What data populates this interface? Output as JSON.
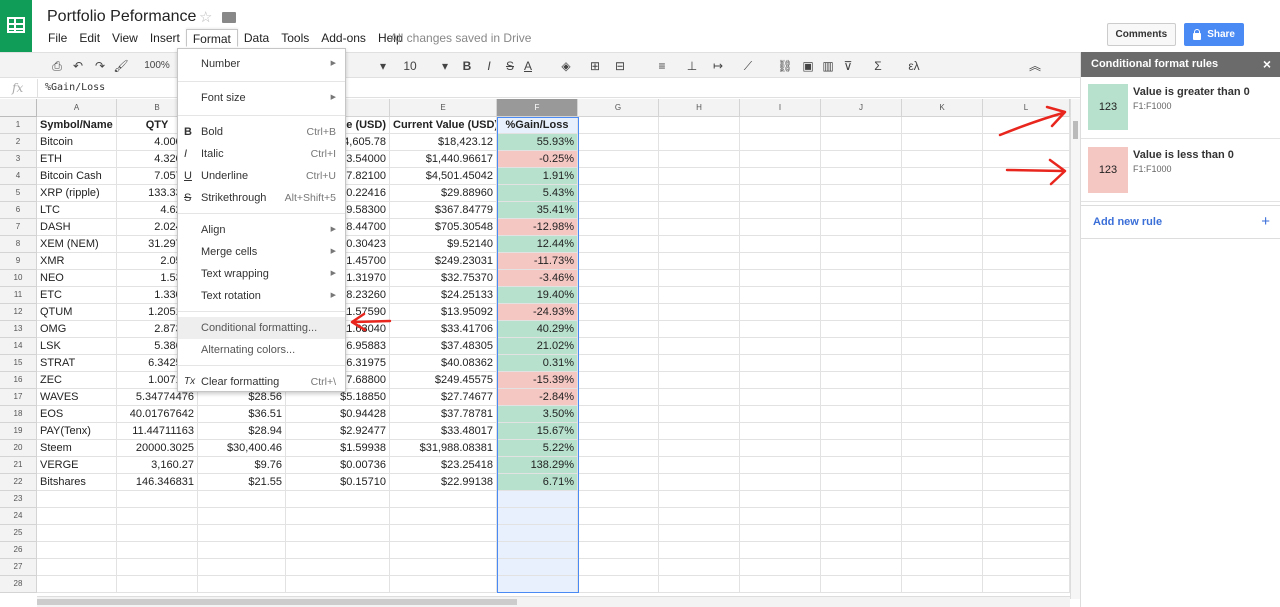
{
  "doc": {
    "title": "Portfolio Peformance",
    "saved_status": "All changes saved in Drive"
  },
  "menu": [
    "File",
    "Edit",
    "View",
    "Insert",
    "Format",
    "Data",
    "Tools",
    "Add-ons",
    "Help"
  ],
  "buttons": {
    "comments": "Comments",
    "share": "Share"
  },
  "toolbar": {
    "zoom": "100%",
    "font_size": "10",
    "items": [
      "print",
      "undo",
      "redo",
      "paint-format",
      "bold",
      "italic",
      "strikethrough",
      "text-color",
      "fill-color",
      "borders",
      "merge",
      "align",
      "valign",
      "wrap",
      "rotate",
      "link",
      "comment",
      "chart",
      "filter",
      "functions",
      "input-tools",
      "collapse"
    ]
  },
  "formula_bar": {
    "fx": "fx",
    "value": "%Gain/Loss"
  },
  "columns": [
    "A",
    "B",
    "C",
    "D",
    "E",
    "F",
    "G",
    "H",
    "I",
    "J",
    "K",
    "L"
  ],
  "rows": [
    "1",
    "2",
    "3",
    "4",
    "5",
    "6",
    "7",
    "8",
    "9",
    "10",
    "11",
    "12",
    "13",
    "14",
    "15",
    "16",
    "17",
    "18",
    "19",
    "20",
    "21",
    "22",
    "23",
    "24",
    "25",
    "26",
    "27",
    "28"
  ],
  "table": {
    "headers": [
      "Symbol/Name",
      "QTY",
      "",
      "e (USD)",
      "Current Value (USD)",
      "%Gain/Loss"
    ],
    "data": [
      [
        "Bitcoin",
        "4.00000",
        "",
        "4,605.78",
        "$18,423.12",
        "55.93%",
        "pos"
      ],
      [
        "ETH",
        "4.32021",
        "",
        "33.54000",
        "$1,440.96617",
        "-0.25%",
        "neg"
      ],
      [
        "Bitcoin Cash",
        "7.05754",
        "",
        "37.82100",
        "$4,501.45042",
        "1.91%",
        "pos"
      ],
      [
        "XRP (ripple)",
        "133.3387",
        "",
        "0.22416",
        "$29.88960",
        "5.43%",
        "pos"
      ],
      [
        "LTC",
        "4.6221",
        "",
        "79.58300",
        "$367.84779",
        "35.41%",
        "pos"
      ],
      [
        "DASH",
        "2.02413",
        "",
        "48.44700",
        "$705.30548",
        "-12.98%",
        "neg"
      ],
      [
        "XEM (NEM)",
        "31.29702",
        "",
        "0.30423",
        "$9.52140",
        "12.44%",
        "pos"
      ],
      [
        "XMR",
        "2.0520",
        "",
        "21.45700",
        "$249.23031",
        "-11.73%",
        "neg"
      ],
      [
        "NEO",
        "1.5363",
        "",
        "21.31970",
        "$32.75370",
        "-3.46%",
        "neg"
      ],
      [
        "ETC",
        "1.33010",
        "",
        "18.23260",
        "$24.25133",
        "19.40%",
        "pos"
      ],
      [
        "QTUM",
        "1.205169",
        "",
        "11.57590",
        "$13.95092",
        "-24.93%",
        "neg"
      ],
      [
        "OMG",
        "2.87325",
        "",
        "11.63040",
        "$33.41706",
        "40.29%",
        "pos"
      ],
      [
        "LSK",
        "5.38640",
        "",
        "6.95883",
        "$37.48305",
        "21.02%",
        "pos"
      ],
      [
        "STRAT",
        "6.342596",
        "",
        "6.31975",
        "$40.08362",
        "0.31%",
        "pos"
      ],
      [
        "ZEC",
        "1.007137",
        "",
        "47.68800",
        "$249.45575",
        "-15.39%",
        "neg"
      ],
      [
        "WAVES",
        "5.34774476",
        "$28.56",
        "$5.18850",
        "$27.74677",
        "-2.84%",
        "neg"
      ],
      [
        "EOS",
        "40.01767642",
        "$36.51",
        "$0.94428",
        "$37.78781",
        "3.50%",
        "pos"
      ],
      [
        "PAY(Tenx)",
        "11.44711163",
        "$28.94",
        "$2.92477",
        "$33.48017",
        "15.67%",
        "pos"
      ],
      [
        "Steem",
        "20000.3025",
        "$30,400.46",
        "$1.59938",
        "$31,988.08381",
        "5.22%",
        "pos"
      ],
      [
        "VERGE",
        "3,160.27",
        "$9.76",
        "$0.00736",
        "$23.25418",
        "138.29%",
        "pos"
      ],
      [
        "Bitshares",
        "146.346831",
        "$21.55",
        "$0.15710",
        "$22.99138",
        "6.71%",
        "pos"
      ]
    ]
  },
  "colors": {
    "pos": "#b7e1cd",
    "neg": "#f4c7c3",
    "sel_col": "#e8f0fe",
    "share": "#4a8af4",
    "annotation": "#e8261e"
  },
  "format_menu": [
    {
      "label": "Number",
      "submenu": true
    },
    {
      "sep": true
    },
    {
      "label": "Font size",
      "submenu": true
    },
    {
      "sep": true
    },
    {
      "label": "Bold",
      "shortcut": "Ctrl+B",
      "icon": "B"
    },
    {
      "label": "Italic",
      "shortcut": "Ctrl+I",
      "icon": "I"
    },
    {
      "label": "Underline",
      "shortcut": "Ctrl+U",
      "icon": "U"
    },
    {
      "label": "Strikethrough",
      "shortcut": "Alt+Shift+5",
      "icon": "S"
    },
    {
      "sep": true
    },
    {
      "label": "Align",
      "submenu": true
    },
    {
      "label": "Merge cells",
      "submenu": true
    },
    {
      "label": "Text wrapping",
      "submenu": true
    },
    {
      "label": "Text rotation",
      "submenu": true
    },
    {
      "sep": true
    },
    {
      "label": "Conditional formatting...",
      "highlight": true
    },
    {
      "label": "Alternating colors..."
    },
    {
      "sep": true
    },
    {
      "label": "Clear formatting",
      "shortcut": "Ctrl+\\",
      "icon": "Tx"
    }
  ],
  "panel": {
    "title": "Conditional format rules",
    "close": "×",
    "rules": [
      {
        "sample": "123",
        "title": "Value is greater than 0",
        "range": "F1:F1000",
        "color": "#b7e1cd"
      },
      {
        "sample": "123",
        "title": "Value is less than 0",
        "range": "F1:F1000",
        "color": "#f4c7c3"
      }
    ],
    "add_rule": "Add new rule",
    "add_plus": "+"
  }
}
